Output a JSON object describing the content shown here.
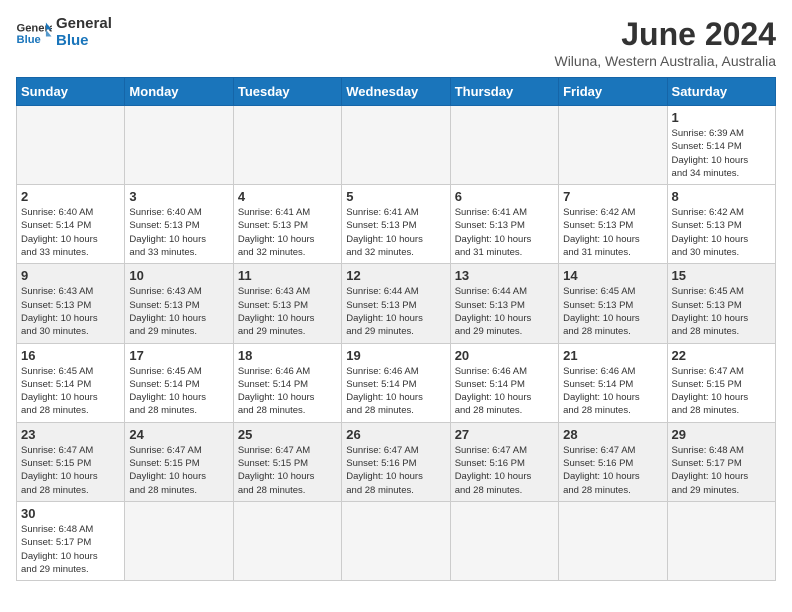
{
  "header": {
    "logo_general": "General",
    "logo_blue": "Blue",
    "month_title": "June 2024",
    "subtitle": "Wiluna, Western Australia, Australia"
  },
  "days_of_week": [
    "Sunday",
    "Monday",
    "Tuesday",
    "Wednesday",
    "Thursday",
    "Friday",
    "Saturday"
  ],
  "weeks": [
    {
      "shaded": false,
      "days": [
        {
          "num": "",
          "info": ""
        },
        {
          "num": "",
          "info": ""
        },
        {
          "num": "",
          "info": ""
        },
        {
          "num": "",
          "info": ""
        },
        {
          "num": "",
          "info": ""
        },
        {
          "num": "",
          "info": ""
        },
        {
          "num": "1",
          "info": "Sunrise: 6:39 AM\nSunset: 5:14 PM\nDaylight: 10 hours\nand 34 minutes."
        }
      ]
    },
    {
      "shaded": false,
      "days": [
        {
          "num": "2",
          "info": "Sunrise: 6:40 AM\nSunset: 5:14 PM\nDaylight: 10 hours\nand 33 minutes."
        },
        {
          "num": "3",
          "info": "Sunrise: 6:40 AM\nSunset: 5:13 PM\nDaylight: 10 hours\nand 33 minutes."
        },
        {
          "num": "4",
          "info": "Sunrise: 6:41 AM\nSunset: 5:13 PM\nDaylight: 10 hours\nand 32 minutes."
        },
        {
          "num": "5",
          "info": "Sunrise: 6:41 AM\nSunset: 5:13 PM\nDaylight: 10 hours\nand 32 minutes."
        },
        {
          "num": "6",
          "info": "Sunrise: 6:41 AM\nSunset: 5:13 PM\nDaylight: 10 hours\nand 31 minutes."
        },
        {
          "num": "7",
          "info": "Sunrise: 6:42 AM\nSunset: 5:13 PM\nDaylight: 10 hours\nand 31 minutes."
        },
        {
          "num": "8",
          "info": "Sunrise: 6:42 AM\nSunset: 5:13 PM\nDaylight: 10 hours\nand 30 minutes."
        }
      ]
    },
    {
      "shaded": true,
      "days": [
        {
          "num": "9",
          "info": "Sunrise: 6:43 AM\nSunset: 5:13 PM\nDaylight: 10 hours\nand 30 minutes."
        },
        {
          "num": "10",
          "info": "Sunrise: 6:43 AM\nSunset: 5:13 PM\nDaylight: 10 hours\nand 29 minutes."
        },
        {
          "num": "11",
          "info": "Sunrise: 6:43 AM\nSunset: 5:13 PM\nDaylight: 10 hours\nand 29 minutes."
        },
        {
          "num": "12",
          "info": "Sunrise: 6:44 AM\nSunset: 5:13 PM\nDaylight: 10 hours\nand 29 minutes."
        },
        {
          "num": "13",
          "info": "Sunrise: 6:44 AM\nSunset: 5:13 PM\nDaylight: 10 hours\nand 29 minutes."
        },
        {
          "num": "14",
          "info": "Sunrise: 6:45 AM\nSunset: 5:13 PM\nDaylight: 10 hours\nand 28 minutes."
        },
        {
          "num": "15",
          "info": "Sunrise: 6:45 AM\nSunset: 5:13 PM\nDaylight: 10 hours\nand 28 minutes."
        }
      ]
    },
    {
      "shaded": false,
      "days": [
        {
          "num": "16",
          "info": "Sunrise: 6:45 AM\nSunset: 5:14 PM\nDaylight: 10 hours\nand 28 minutes."
        },
        {
          "num": "17",
          "info": "Sunrise: 6:45 AM\nSunset: 5:14 PM\nDaylight: 10 hours\nand 28 minutes."
        },
        {
          "num": "18",
          "info": "Sunrise: 6:46 AM\nSunset: 5:14 PM\nDaylight: 10 hours\nand 28 minutes."
        },
        {
          "num": "19",
          "info": "Sunrise: 6:46 AM\nSunset: 5:14 PM\nDaylight: 10 hours\nand 28 minutes."
        },
        {
          "num": "20",
          "info": "Sunrise: 6:46 AM\nSunset: 5:14 PM\nDaylight: 10 hours\nand 28 minutes."
        },
        {
          "num": "21",
          "info": "Sunrise: 6:46 AM\nSunset: 5:14 PM\nDaylight: 10 hours\nand 28 minutes."
        },
        {
          "num": "22",
          "info": "Sunrise: 6:47 AM\nSunset: 5:15 PM\nDaylight: 10 hours\nand 28 minutes."
        }
      ]
    },
    {
      "shaded": true,
      "days": [
        {
          "num": "23",
          "info": "Sunrise: 6:47 AM\nSunset: 5:15 PM\nDaylight: 10 hours\nand 28 minutes."
        },
        {
          "num": "24",
          "info": "Sunrise: 6:47 AM\nSunset: 5:15 PM\nDaylight: 10 hours\nand 28 minutes."
        },
        {
          "num": "25",
          "info": "Sunrise: 6:47 AM\nSunset: 5:15 PM\nDaylight: 10 hours\nand 28 minutes."
        },
        {
          "num": "26",
          "info": "Sunrise: 6:47 AM\nSunset: 5:16 PM\nDaylight: 10 hours\nand 28 minutes."
        },
        {
          "num": "27",
          "info": "Sunrise: 6:47 AM\nSunset: 5:16 PM\nDaylight: 10 hours\nand 28 minutes."
        },
        {
          "num": "28",
          "info": "Sunrise: 6:47 AM\nSunset: 5:16 PM\nDaylight: 10 hours\nand 28 minutes."
        },
        {
          "num": "29",
          "info": "Sunrise: 6:48 AM\nSunset: 5:17 PM\nDaylight: 10 hours\nand 29 minutes."
        }
      ]
    },
    {
      "shaded": false,
      "days": [
        {
          "num": "30",
          "info": "Sunrise: 6:48 AM\nSunset: 5:17 PM\nDaylight: 10 hours\nand 29 minutes."
        },
        {
          "num": "",
          "info": ""
        },
        {
          "num": "",
          "info": ""
        },
        {
          "num": "",
          "info": ""
        },
        {
          "num": "",
          "info": ""
        },
        {
          "num": "",
          "info": ""
        },
        {
          "num": "",
          "info": ""
        }
      ]
    }
  ]
}
